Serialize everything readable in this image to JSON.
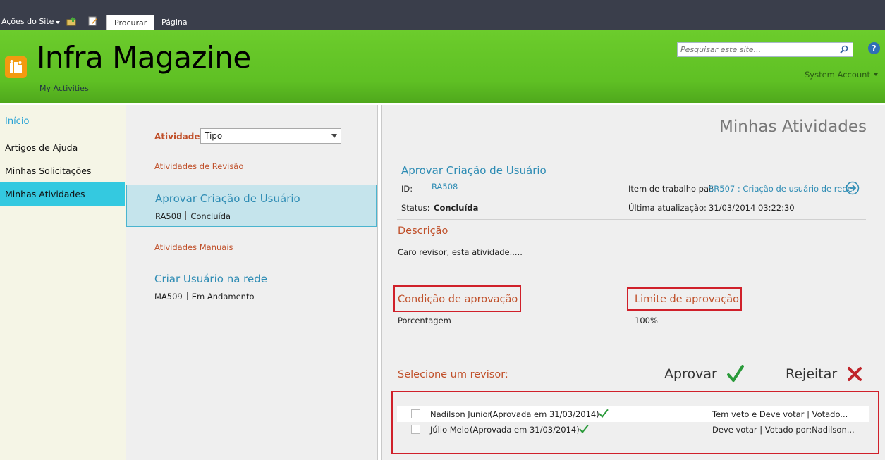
{
  "ribbon": {
    "site_actions": "Ações do Site",
    "tabs": [
      {
        "label": "Procurar",
        "active": true
      },
      {
        "label": "Página",
        "active": false
      }
    ]
  },
  "header": {
    "title": "Infra Magazine",
    "subtitle": "My Activities",
    "search_placeholder": "Pesquisar este site...",
    "help": "?",
    "account": "System Account",
    "colors": {
      "header_green": "#5fc024",
      "ribbon": "#3a3e4b"
    }
  },
  "leftnav": {
    "home": "Início",
    "items": [
      {
        "label": "Artigos de Ajuda",
        "active": false
      },
      {
        "label": "Minhas Solicitações",
        "active": false
      },
      {
        "label": "Minhas Atividades",
        "active": true
      }
    ],
    "accent": "#34c9e0"
  },
  "activities": {
    "label": "Atividades",
    "type_select": "Tipo",
    "groups": [
      {
        "label": "Atividades de Revisão",
        "items": [
          {
            "title": "Aprovar Criação de Usuário",
            "id": "RA508",
            "status": "Concluída",
            "selected": true
          }
        ]
      },
      {
        "label": "Atividades Manuais",
        "items": [
          {
            "title": "Criar Usuário na rede",
            "id": "MA509",
            "status": "Em Andamento",
            "selected": false
          }
        ]
      }
    ]
  },
  "detail": {
    "page_title": "Minhas Atividades",
    "title": "Aprovar Criação de Usuário",
    "id_label": "ID:",
    "id_value": "RA508",
    "status_label": "Status:",
    "status_value": "Concluída",
    "parent_label": "Item de trabalho pai:",
    "parent_value": "SR507 : Criação de usuário de rede",
    "updated_label": "Última atualização:",
    "updated_value": "31/03/2014 03:22:30",
    "description_label": "Descrição",
    "description_text": "Caro revisor, esta atividade.....",
    "condition_label": "Condição de aprovação",
    "condition_value": "Porcentagem",
    "limit_label": "Limite de aprovação",
    "limit_value": "100%",
    "select_reviewer": "Selecione um revisor:",
    "approve": "Aprovar",
    "reject": "Rejeitar",
    "reviewers": [
      {
        "name": "Nadilson Junior",
        "status": "(Aprovada em 31/03/2014)",
        "votes": "Tem veto e Deve votar | Votado..."
      },
      {
        "name": "Júlio Melo",
        "status": "(Aprovada em 31/03/2014)",
        "votes": "Deve votar | Votado por:Nadilson..."
      }
    ],
    "colors": {
      "section": "#c0502a",
      "link": "#2e8cb4",
      "approve": "#2a9a3a",
      "reject": "#c0262c",
      "highlight_box": "#d0202a"
    }
  }
}
